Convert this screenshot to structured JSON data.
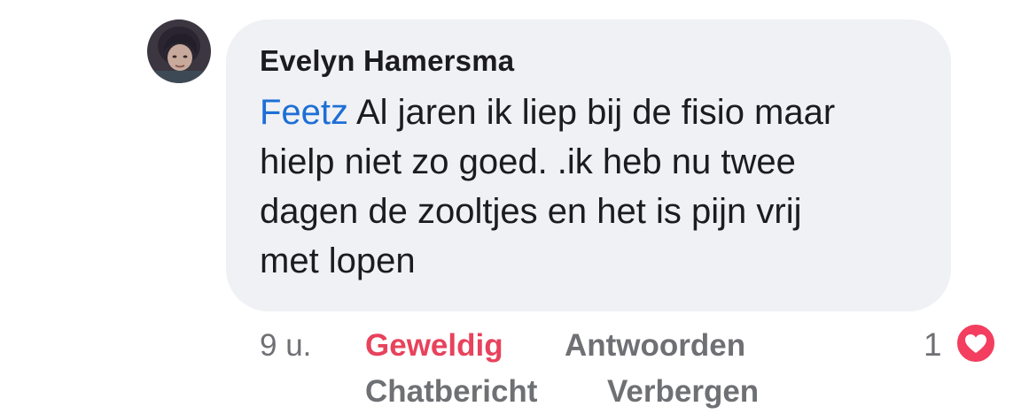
{
  "comment": {
    "author": "Evelyn Hamersma",
    "mention": "Feetz",
    "text": " Al jaren ik liep bij de fisio maar\nhielp niet zo goed. .ik heb nu twee\ndagen de zooltjes en het is pijn vrij\nmet lopen",
    "avatar_icon": "profile-photo"
  },
  "meta": {
    "time": "9 u.",
    "like_label": "Geweldig",
    "reply_label": "Antwoorden",
    "message_label": "Chatbericht",
    "hide_label": "Verbergen"
  },
  "reactions": {
    "count": "1",
    "icon": "heart-icon",
    "color": "#f43e5f"
  },
  "colors": {
    "bubble": "#f0f1f5",
    "mention": "#1d6fd6",
    "like_active": "#e8425c",
    "meta_text": "#6f7074"
  }
}
